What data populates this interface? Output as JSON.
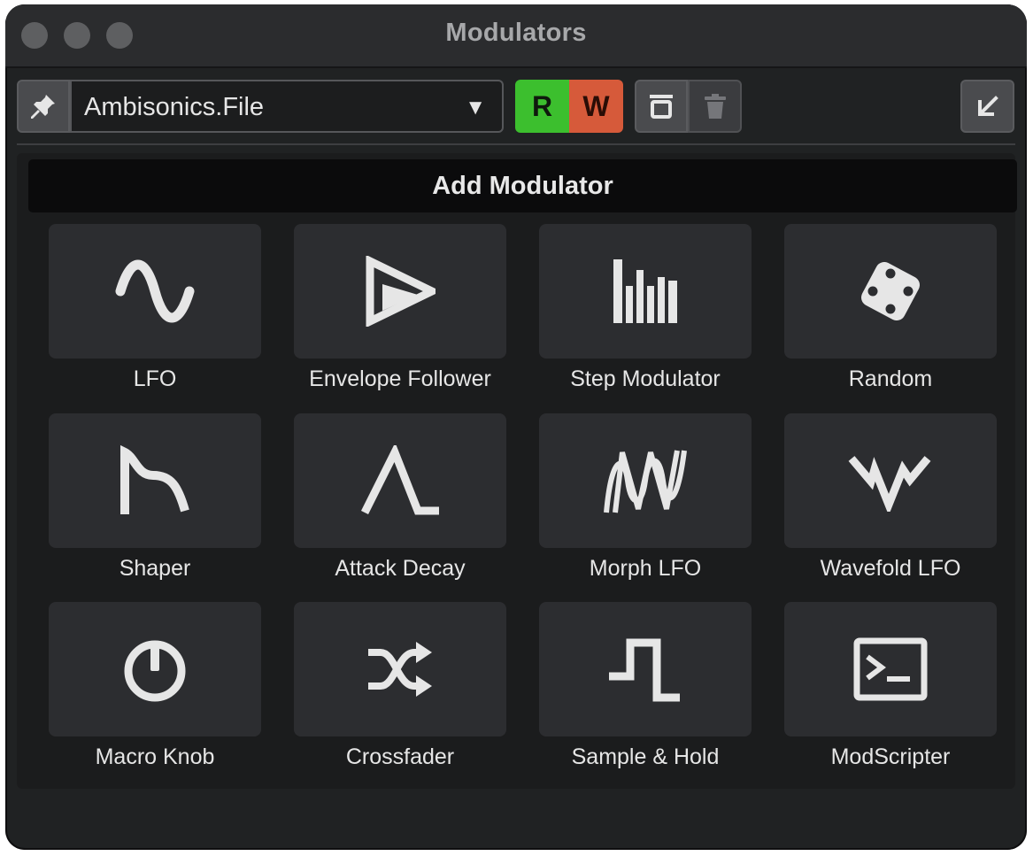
{
  "window": {
    "title": "Modulators"
  },
  "toolbar": {
    "preset_name": "Ambisonics.File",
    "dropdown_arrow": "▼",
    "read_label": "R",
    "write_label": "W",
    "icons": {
      "pin": "pin-icon",
      "snapshot": "snapshot-icon",
      "trash": "trash-icon",
      "collapse": "arrow-down-left-icon"
    },
    "colors": {
      "read": "#3cbf2e",
      "write": "#d65a3a"
    }
  },
  "panel": {
    "header": "Add Modulator",
    "tiles": [
      {
        "label": "LFO",
        "icon": "sine-wave-icon"
      },
      {
        "label": "Envelope Follower",
        "icon": "envelope-follower-icon"
      },
      {
        "label": "Step Modulator",
        "icon": "step-bars-icon"
      },
      {
        "label": "Random",
        "icon": "dice-icon"
      },
      {
        "label": "Shaper",
        "icon": "shaper-curve-icon"
      },
      {
        "label": "Attack Decay",
        "icon": "attack-decay-icon"
      },
      {
        "label": "Morph LFO",
        "icon": "morph-wave-icon"
      },
      {
        "label": "Wavefold LFO",
        "icon": "wavefold-icon"
      },
      {
        "label": "Macro Knob",
        "icon": "power-knob-icon"
      },
      {
        "label": "Crossfader",
        "icon": "shuffle-icon"
      },
      {
        "label": "Sample & Hold",
        "icon": "square-pulse-icon"
      },
      {
        "label": "ModScripter",
        "icon": "terminal-icon"
      }
    ]
  }
}
